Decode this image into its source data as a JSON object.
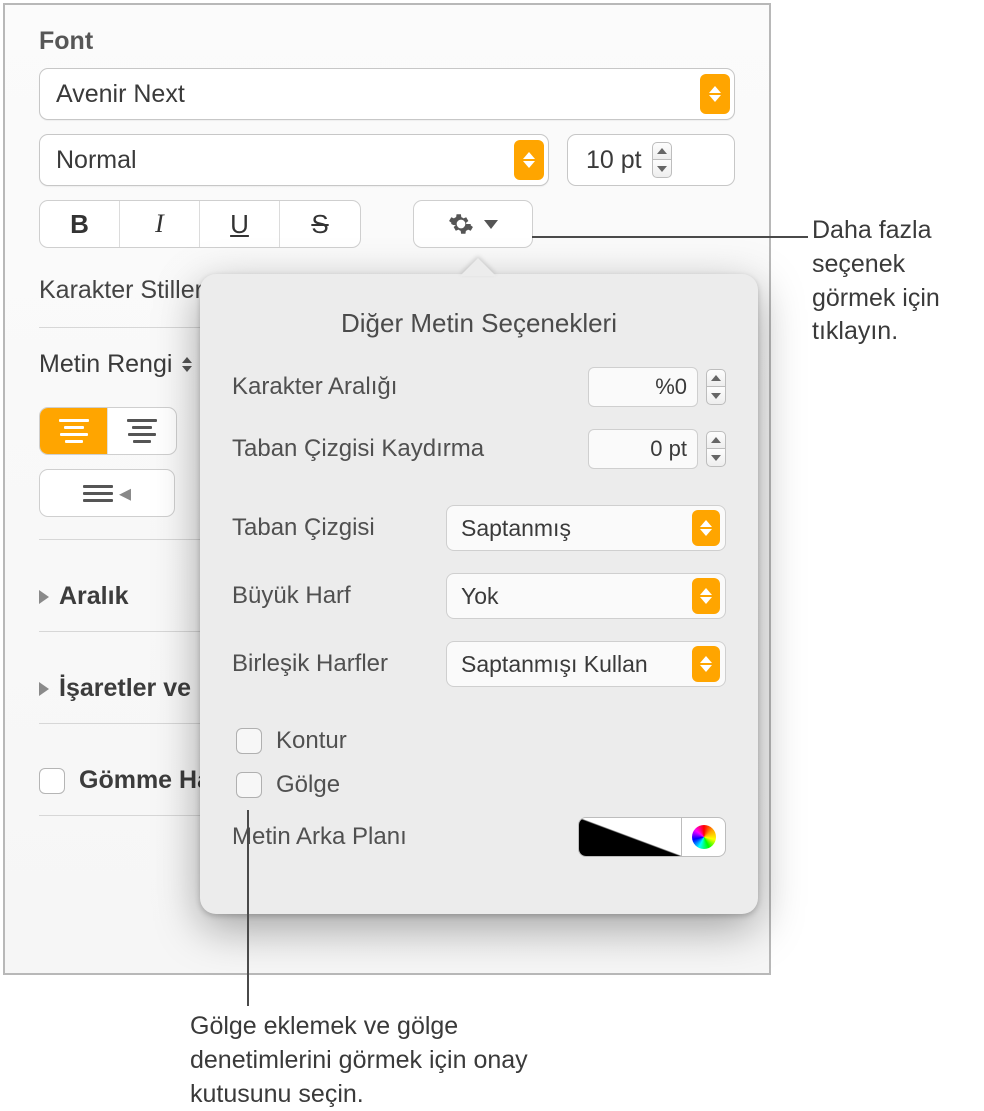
{
  "font": {
    "section_title": "Font",
    "family": "Avenir Next",
    "weight": "Normal",
    "size": "10 pt",
    "bold": "B",
    "italic": "I",
    "underline": "U",
    "strike": "S"
  },
  "char_styles_label": "Karakter Stilleri",
  "text_color_label": "Metin Rengi",
  "spacing_label": "Aralık",
  "bullets_label": "İşaretler ve",
  "dropcap_label": "Gömme Ha",
  "popover": {
    "title": "Diğer Metin Seçenekleri",
    "char_spacing_label": "Karakter Aralığı",
    "char_spacing_value": "%0",
    "baseline_shift_label": "Taban Çizgisi Kaydırma",
    "baseline_shift_value": "0 pt",
    "baseline_label": "Taban Çizgisi",
    "baseline_value": "Saptanmış",
    "caps_label": "Büyük Harf",
    "caps_value": "Yok",
    "ligatures_label": "Birleşik Harfler",
    "ligatures_value": "Saptanmışı Kullan",
    "outline_label": "Kontur",
    "shadow_label": "Gölge",
    "text_bg_label": "Metin Arka Planı"
  },
  "callouts": {
    "more_options": "Daha fazla seçenek görmek için tıklayın.",
    "shadow_hint": "Gölge eklemek ve gölge denetimlerini görmek için onay kutusunu seçin."
  }
}
